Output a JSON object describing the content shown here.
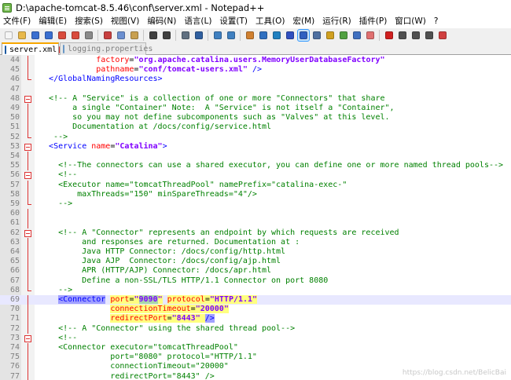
{
  "window": {
    "title": "D:\\apache-tomcat-8.5.46\\conf\\server.xml - Notepad++"
  },
  "menu": [
    "文件(F)",
    "编辑(E)",
    "搜索(S)",
    "视图(V)",
    "编码(N)",
    "语言(L)",
    "设置(T)",
    "工具(O)",
    "宏(M)",
    "运行(R)",
    "插件(P)",
    "窗口(W)",
    "?"
  ],
  "toolbar": {
    "icons": [
      {
        "name": "new-file-icon",
        "color": "#f5f5f5"
      },
      {
        "name": "open-file-icon",
        "color": "#e8b84a"
      },
      {
        "name": "save-icon",
        "color": "#3a6fd0"
      },
      {
        "name": "save-all-icon",
        "color": "#3a6fd0"
      },
      {
        "name": "close-icon",
        "color": "#d94b3c"
      },
      {
        "name": "close-all-icon",
        "color": "#d94b3c"
      },
      {
        "name": "print-icon",
        "color": "#8a8a8a"
      },
      {
        "sep": true
      },
      {
        "name": "cut-icon",
        "color": "#c84040"
      },
      {
        "name": "copy-icon",
        "color": "#6b8fd0"
      },
      {
        "name": "paste-icon",
        "color": "#c8a050"
      },
      {
        "sep": true
      },
      {
        "name": "undo-icon",
        "color": "#404040"
      },
      {
        "name": "redo-icon",
        "color": "#404040"
      },
      {
        "sep": true
      },
      {
        "name": "find-icon",
        "color": "#607080"
      },
      {
        "name": "replace-icon",
        "color": "#3060a0"
      },
      {
        "sep": true
      },
      {
        "name": "zoom-in-icon",
        "color": "#4080c0"
      },
      {
        "name": "zoom-out-icon",
        "color": "#4080c0"
      },
      {
        "sep": true
      },
      {
        "name": "sync-v-icon",
        "color": "#d08030"
      },
      {
        "name": "sync-h-icon",
        "color": "#3070c0"
      },
      {
        "name": "word-wrap-icon",
        "color": "#2080c0"
      },
      {
        "name": "show-all-chars-icon",
        "color": "#3050c0"
      },
      {
        "name": "indent-guide-icon",
        "color": "#3060c0",
        "active": true
      },
      {
        "name": "udl-icon",
        "color": "#5070a0"
      },
      {
        "name": "doc-map-icon",
        "color": "#d0a020"
      },
      {
        "name": "function-list-icon",
        "color": "#50a040"
      },
      {
        "name": "folder-as-workspace-icon",
        "color": "#4070c0"
      },
      {
        "name": "monitoring-icon",
        "color": "#e07070"
      },
      {
        "sep": true
      },
      {
        "name": "record-macro-icon",
        "color": "#d02020"
      },
      {
        "name": "stop-macro-icon",
        "color": "#505050"
      },
      {
        "name": "play-macro-icon",
        "color": "#505050"
      },
      {
        "name": "run-macro-multiple-icon",
        "color": "#505050"
      },
      {
        "name": "save-macro-icon",
        "color": "#d04040"
      }
    ]
  },
  "tabs": [
    {
      "label": "server.xml",
      "active": true
    },
    {
      "label": "logging.properties",
      "active": false
    }
  ],
  "editor": {
    "current_line": 69,
    "lines": [
      {
        "n": "44",
        "fold": "bar",
        "s": [
          [
            "            ",
            "txt"
          ],
          [
            "factory",
            "attr"
          ],
          [
            "=",
            "txt"
          ],
          [
            "\"org.apache.catalina.users.MemoryUserDatabaseFactory\"",
            "val"
          ]
        ]
      },
      {
        "n": "45",
        "fold": "bar",
        "s": [
          [
            "            ",
            "txt"
          ],
          [
            "pathname",
            "attr"
          ],
          [
            "=",
            "txt"
          ],
          [
            "\"conf/tomcat-users.xml\"",
            "val"
          ],
          [
            " />",
            "tag"
          ]
        ]
      },
      {
        "n": "46",
        "fold": "end",
        "s": [
          [
            "  ",
            "txt"
          ],
          [
            "</GlobalNamingResources>",
            "tag"
          ]
        ]
      },
      {
        "n": "47",
        "fold": "",
        "s": []
      },
      {
        "n": "48",
        "fold": "box",
        "s": [
          [
            "  ",
            "txt"
          ],
          [
            "<!-- A \"Service\" is a collection of one or more \"Connectors\" that share",
            "cmt"
          ]
        ]
      },
      {
        "n": "49",
        "fold": "bar",
        "s": [
          [
            "       a single \"Container\" Note:  A \"Service\" is not itself a \"Container\",",
            "cmt"
          ]
        ]
      },
      {
        "n": "50",
        "fold": "bar",
        "s": [
          [
            "       so you may not define subcomponents such as \"Valves\" at this level.",
            "cmt"
          ]
        ]
      },
      {
        "n": "51",
        "fold": "bar",
        "s": [
          [
            "       Documentation at /docs/config/service.html",
            "cmt"
          ]
        ]
      },
      {
        "n": "52",
        "fold": "end",
        "s": [
          [
            "   -->",
            "cmt"
          ]
        ]
      },
      {
        "n": "53",
        "fold": "box",
        "s": [
          [
            "  ",
            "txt"
          ],
          [
            "<Service",
            "tag"
          ],
          [
            " name",
            "attr"
          ],
          [
            "=",
            "txt"
          ],
          [
            "\"Catalina\"",
            "val"
          ],
          [
            ">",
            "tag"
          ]
        ]
      },
      {
        "n": "54",
        "fold": "bar",
        "s": []
      },
      {
        "n": "55",
        "fold": "bar",
        "s": [
          [
            "    ",
            "txt"
          ],
          [
            "<!--The connectors can use a shared executor, you can define one or more named thread pools-->",
            "cmt"
          ]
        ]
      },
      {
        "n": "56",
        "fold": "box",
        "s": [
          [
            "    ",
            "txt"
          ],
          [
            "<!--",
            "cmt"
          ]
        ]
      },
      {
        "n": "57",
        "fold": "bar",
        "s": [
          [
            "    <Executor name=\"tomcatThreadPool\" namePrefix=\"catalina-exec-\"",
            "cmt"
          ]
        ]
      },
      {
        "n": "58",
        "fold": "bar",
        "s": [
          [
            "        maxThreads=\"150\" minSpareThreads=\"4\"/>",
            "cmt"
          ]
        ]
      },
      {
        "n": "59",
        "fold": "end",
        "s": [
          [
            "    -->",
            "cmt"
          ]
        ]
      },
      {
        "n": "60",
        "fold": "bar",
        "s": []
      },
      {
        "n": "61",
        "fold": "bar",
        "s": []
      },
      {
        "n": "62",
        "fold": "box",
        "s": [
          [
            "    ",
            "txt"
          ],
          [
            "<!-- A \"Connector\" represents an endpoint by which requests are received",
            "cmt"
          ]
        ]
      },
      {
        "n": "63",
        "fold": "bar",
        "s": [
          [
            "         and responses are returned. Documentation at :",
            "cmt"
          ]
        ]
      },
      {
        "n": "64",
        "fold": "bar",
        "s": [
          [
            "         Java HTTP Connector: /docs/config/http.html",
            "cmt"
          ]
        ]
      },
      {
        "n": "65",
        "fold": "bar",
        "s": [
          [
            "         Java AJP  Connector: /docs/config/ajp.html",
            "cmt"
          ]
        ]
      },
      {
        "n": "66",
        "fold": "bar",
        "s": [
          [
            "         APR (HTTP/AJP) Connector: /docs/apr.html",
            "cmt"
          ]
        ]
      },
      {
        "n": "67",
        "fold": "bar",
        "s": [
          [
            "         Define a non-SSL/TLS HTTP/1.1 Connector on port 8080",
            "cmt"
          ]
        ]
      },
      {
        "n": "68",
        "fold": "end",
        "s": [
          [
            "    -->",
            "cmt"
          ]
        ]
      },
      {
        "n": "69",
        "fold": "bar",
        "s": [
          [
            "    ",
            "txt"
          ],
          [
            "<Connector",
            "tag",
            "b"
          ],
          [
            " ",
            "txt"
          ],
          [
            "port",
            "attr",
            "y"
          ],
          [
            "=",
            "txt",
            "y"
          ],
          [
            "\"",
            "val",
            "y"
          ],
          [
            "9090",
            "val",
            "g"
          ],
          [
            "\"",
            "val",
            "y"
          ],
          [
            " ",
            "txt"
          ],
          [
            "protocol",
            "attr",
            "y"
          ],
          [
            "=",
            "txt",
            "y"
          ],
          [
            "\"HTTP/1.1\"",
            "val",
            "y"
          ]
        ]
      },
      {
        "n": "70",
        "fold": "bar",
        "s": [
          [
            "               ",
            "txt"
          ],
          [
            "connectionTimeout",
            "attr",
            "y"
          ],
          [
            "=",
            "txt",
            "y"
          ],
          [
            "\"20000\"",
            "val",
            "y"
          ]
        ]
      },
      {
        "n": "71",
        "fold": "bar",
        "s": [
          [
            "               ",
            "txt"
          ],
          [
            "redirectPort",
            "attr",
            "y"
          ],
          [
            "=",
            "txt",
            "y"
          ],
          [
            "\"8443\"",
            "val",
            "y"
          ],
          [
            " ",
            "txt",
            "y"
          ],
          [
            "/>",
            "tag",
            "b"
          ]
        ]
      },
      {
        "n": "72",
        "fold": "bar",
        "s": [
          [
            "    ",
            "txt"
          ],
          [
            "<!-- A \"Connector\" using the shared thread pool-->",
            "cmt"
          ]
        ]
      },
      {
        "n": "73",
        "fold": "box",
        "s": [
          [
            "    ",
            "txt"
          ],
          [
            "<!--",
            "cmt"
          ]
        ]
      },
      {
        "n": "74",
        "fold": "bar",
        "s": [
          [
            "    <Connector executor=\"tomcatThreadPool\"",
            "cmt"
          ]
        ]
      },
      {
        "n": "75",
        "fold": "bar",
        "s": [
          [
            "               port=\"8080\" protocol=\"HTTP/1.1\"",
            "cmt"
          ]
        ]
      },
      {
        "n": "76",
        "fold": "bar",
        "s": [
          [
            "               connectionTimeout=\"20000\"",
            "cmt"
          ]
        ]
      },
      {
        "n": "77",
        "fold": "bar",
        "s": [
          [
            "               redirectPort=\"8443\" />",
            "cmt"
          ]
        ]
      }
    ]
  },
  "watermark": "https://blog.csdn.net/BelicBai"
}
